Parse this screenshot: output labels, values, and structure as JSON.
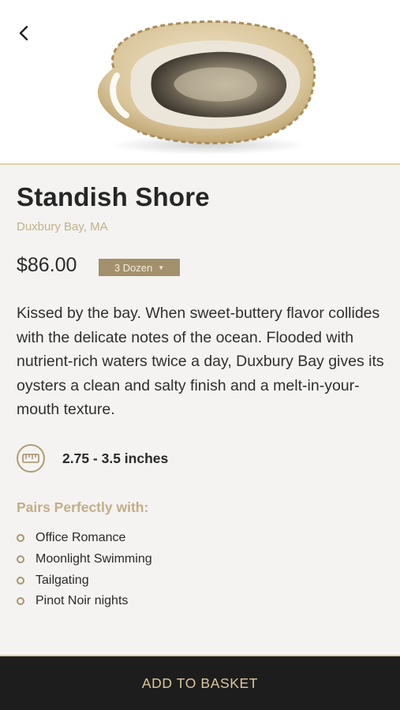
{
  "header": {
    "back_icon": "chevron-left-icon",
    "hero_image": "oyster-photo"
  },
  "product": {
    "name": "Standish Shore",
    "location": "Duxbury Bay, MA",
    "price": "$86.00",
    "quantity_selected": "3 Dozen",
    "description": "Kissed by the bay. When sweet-buttery flavor collides with the delicate notes of the ocean. Flooded with nutrient-rich waters twice a day, Duxbury Bay gives its oysters a clean and salty finish and a melt-in-your-mouth texture.",
    "size_icon": "ruler-icon",
    "size": "2.75 - 3.5 inches"
  },
  "pairs": {
    "heading": "Pairs Perfectly with:",
    "items": [
      "Office Romance",
      "Moonlight Swimming",
      "Tailgating",
      "Pinot Noir nights"
    ]
  },
  "footer": {
    "add_to_basket_label": "ADD TO BASKET"
  },
  "colors": {
    "accent_gold": "#c2b08a",
    "select_bg": "#a3906c",
    "footer_bg": "#1d1d1d",
    "footer_text": "#dcc89e"
  }
}
